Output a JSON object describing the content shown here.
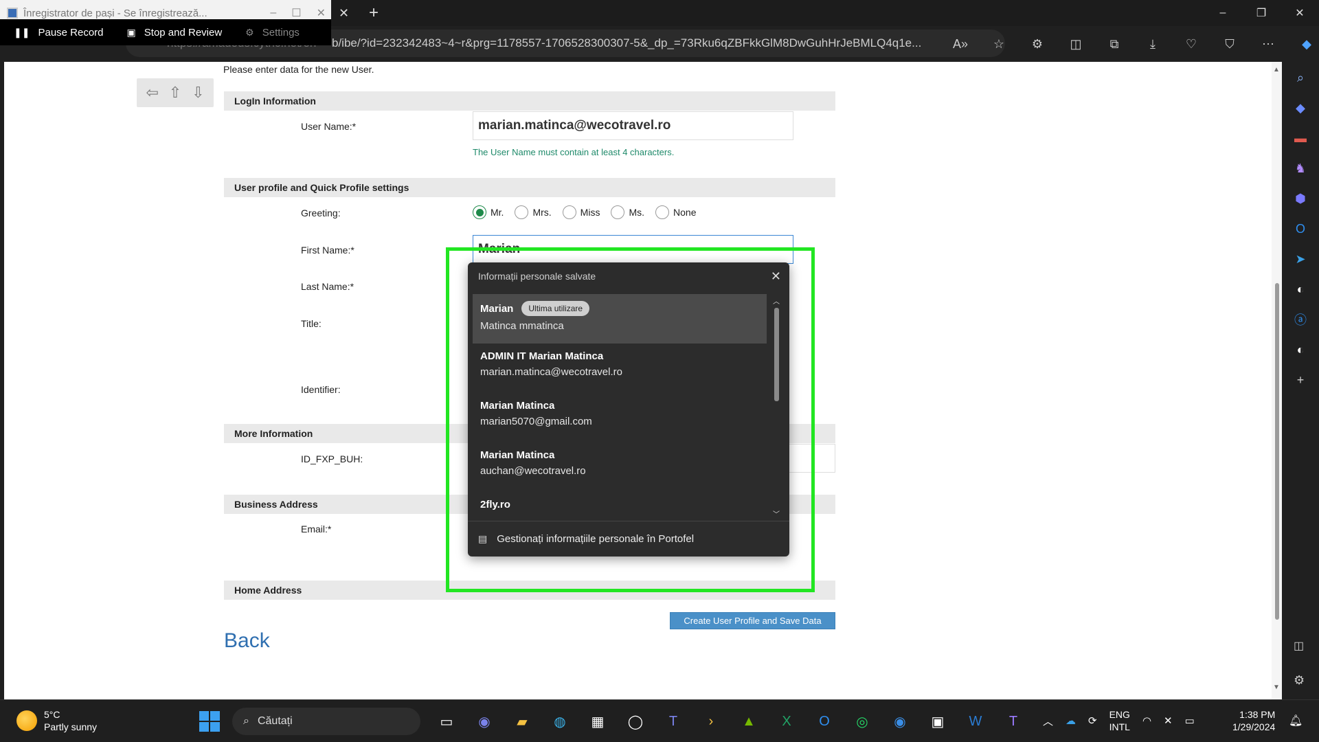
{
  "window": {
    "tab_title": "Înregistrator de pași - Se înregistrează...",
    "url_host": "https://amadeus.cytric.net/en",
    "url_path": "b/ibe/?id=232342483~4~r&prg=1178557-1706528300307-5&_dp_=73Rku6qZBFkkGlM8DwGuhHrJeBMLQ4q1e..."
  },
  "recorder": {
    "pause_label": "Pause Record",
    "stop_label": "Stop and Review",
    "settings_label": "Settings"
  },
  "page": {
    "intro": "Please enter data for the new User.",
    "sections": {
      "login": "LogIn Information",
      "profile": "User profile and Quick Profile settings",
      "more": "More Information",
      "business": "Business Address",
      "home": "Home Address"
    },
    "labels": {
      "username": "User Name:*",
      "greeting": "Greeting:",
      "first_name": "First Name:*",
      "last_name": "Last Name:*",
      "title": "Title:",
      "identifier": "Identifier:",
      "id_fxp": "ID_FXP_BUH:",
      "email": "Email:*"
    },
    "username_value": "marian.matinca@wecotravel.ro",
    "username_hint": "The User Name must contain at least 4 characters.",
    "greeting_options": [
      "Mr.",
      "Mrs.",
      "Miss",
      "Ms.",
      "None"
    ],
    "greeting_selected": "Mr.",
    "first_name_value": "Marian",
    "submit_label": "Create User Profile and Save Data",
    "back_label": "Back"
  },
  "autofill": {
    "header": "Informații personale salvate",
    "items": [
      {
        "line1": "Marian",
        "badge": "Ultima utilizare",
        "line2": "Matinca  mmatinca"
      },
      {
        "line1": "ADMIN IT Marian Matinca",
        "line2": "marian.matinca@wecotravel.ro"
      },
      {
        "line1": "Marian Matinca",
        "line2": "marian5070@gmail.com"
      },
      {
        "line1": "Marian Matinca",
        "line2": "auchan@wecotravel.ro"
      },
      {
        "line1": "2fly.ro",
        "line2": ""
      }
    ],
    "footer": "Gestionați informațiile personale în Portofel"
  },
  "taskbar": {
    "temp": "5°C",
    "weather": "Partly sunny",
    "search": "Căutați",
    "lang1": "ENG",
    "lang2": "INTL",
    "time": "1:38 PM",
    "date": "1/29/2024"
  },
  "colors": {
    "highlight": "#22e622",
    "selected_radio": "#1e8a4a",
    "submit_button": "#4a90c8",
    "link": "#2f6fb0"
  }
}
